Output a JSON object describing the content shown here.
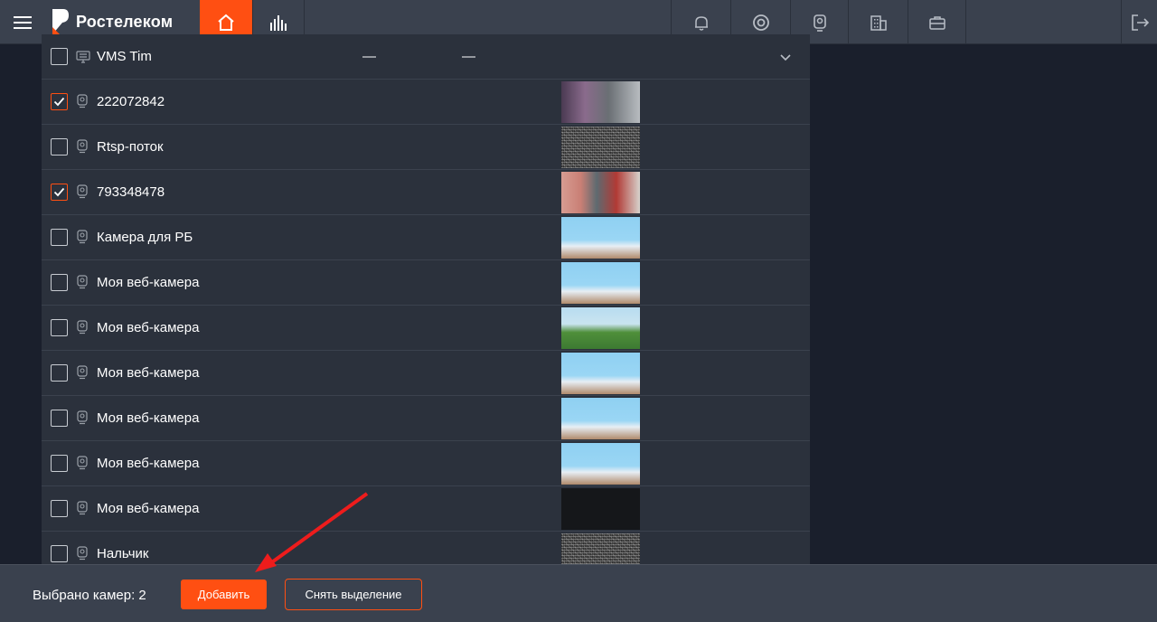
{
  "brand": {
    "name": "Ростелеком",
    "accent": "#ff4f12"
  },
  "topbar": {
    "icons": [
      "menu-icon",
      "home-icon",
      "stats-icon",
      "bell-icon",
      "lifebuoy-icon",
      "camera-icon",
      "building-icon",
      "briefcase-icon",
      "logout-icon"
    ]
  },
  "group": {
    "name": "VMS Tim",
    "col1": "—",
    "col2": "—"
  },
  "cameras": [
    {
      "name": "222072842",
      "checked": true,
      "thumb": "office"
    },
    {
      "name": "Rtsp-поток",
      "checked": false,
      "thumb": "noise"
    },
    {
      "name": "793348478",
      "checked": true,
      "thumb": "room"
    },
    {
      "name": "Камера для РБ",
      "checked": false,
      "thumb": "cartoon"
    },
    {
      "name": "Моя веб-камера",
      "checked": false,
      "thumb": "cartoon"
    },
    {
      "name": "Моя веб-камера",
      "checked": false,
      "thumb": "cartoon2"
    },
    {
      "name": "Моя веб-камера",
      "checked": false,
      "thumb": "cartoon"
    },
    {
      "name": "Моя веб-камера",
      "checked": false,
      "thumb": "cartoon"
    },
    {
      "name": "Моя веб-камера",
      "checked": false,
      "thumb": "cartoon"
    },
    {
      "name": "Моя веб-камера",
      "checked": false,
      "thumb": "darkcam"
    },
    {
      "name": "Нальчик",
      "checked": false,
      "thumb": "noise"
    }
  ],
  "footer": {
    "selected_label": "Выбрано камер: 2",
    "add_button": "Добавить",
    "clear_button": "Снять выделение"
  }
}
